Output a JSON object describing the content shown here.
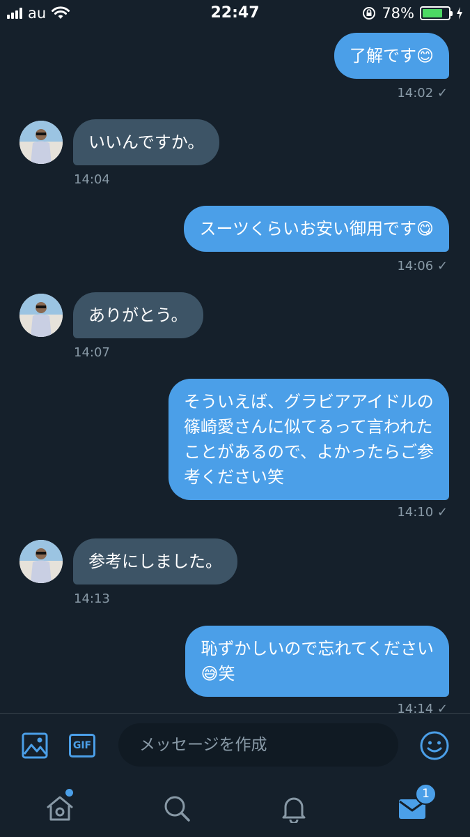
{
  "status_bar": {
    "carrier": "au",
    "time": "22:47",
    "battery_percent": "78%",
    "battery_level": 0.78,
    "battery_color": "#4cd964"
  },
  "messages": [
    {
      "side": "sent",
      "text": "了解です😊",
      "time": "14:02 ✓"
    },
    {
      "side": "recv",
      "text": "いいんですか。",
      "time": "14:04"
    },
    {
      "side": "sent",
      "text": "スーツくらいお安い御用です😋",
      "time": "14:06 ✓"
    },
    {
      "side": "recv",
      "text": "ありがとう。",
      "time": "14:07"
    },
    {
      "side": "sent",
      "lines": [
        "そういえば、グラビアアイドルの",
        "篠崎愛さんに似てるって言われた",
        "ことがあるので、よかったらご参",
        "考ください笑"
      ],
      "time": "14:10 ✓"
    },
    {
      "side": "recv",
      "text": "参考にしました。",
      "time": "14:13"
    },
    {
      "side": "sent",
      "lines": [
        "恥ずかしいので忘れてください",
        "😅笑"
      ],
      "time": "14:14 ✓"
    }
  ],
  "compose": {
    "placeholder": "メッセージを作成",
    "gif_label": "GIF"
  },
  "tab_bar": {
    "messages_badge": "1"
  },
  "colors": {
    "background": "#15202b",
    "accent": "#4b9fe8",
    "received_bubble": "#3d5466",
    "muted_text": "#8899a6"
  },
  "icons": [
    "wifi-icon",
    "rotation-lock-icon",
    "charging-icon",
    "image-icon",
    "gif-icon",
    "emoji-icon",
    "home-icon",
    "search-icon",
    "notifications-icon",
    "messages-icon"
  ]
}
